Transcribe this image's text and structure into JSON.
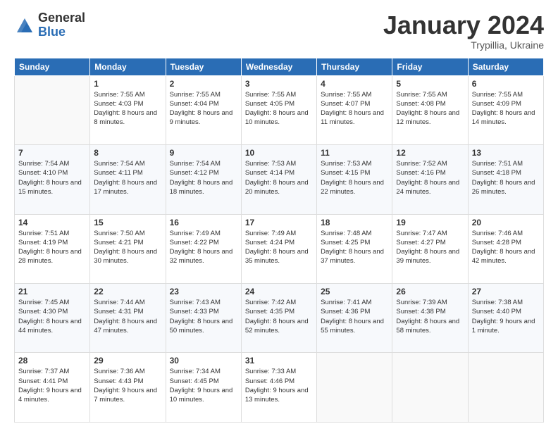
{
  "header": {
    "logo_general": "General",
    "logo_blue": "Blue",
    "month_title": "January 2024",
    "subtitle": "Trypillia, Ukraine"
  },
  "weekdays": [
    "Sunday",
    "Monday",
    "Tuesday",
    "Wednesday",
    "Thursday",
    "Friday",
    "Saturday"
  ],
  "weeks": [
    [
      {
        "day": "",
        "sunrise": "",
        "sunset": "",
        "daylight": ""
      },
      {
        "day": "1",
        "sunrise": "Sunrise: 7:55 AM",
        "sunset": "Sunset: 4:03 PM",
        "daylight": "Daylight: 8 hours and 8 minutes."
      },
      {
        "day": "2",
        "sunrise": "Sunrise: 7:55 AM",
        "sunset": "Sunset: 4:04 PM",
        "daylight": "Daylight: 8 hours and 9 minutes."
      },
      {
        "day": "3",
        "sunrise": "Sunrise: 7:55 AM",
        "sunset": "Sunset: 4:05 PM",
        "daylight": "Daylight: 8 hours and 10 minutes."
      },
      {
        "day": "4",
        "sunrise": "Sunrise: 7:55 AM",
        "sunset": "Sunset: 4:07 PM",
        "daylight": "Daylight: 8 hours and 11 minutes."
      },
      {
        "day": "5",
        "sunrise": "Sunrise: 7:55 AM",
        "sunset": "Sunset: 4:08 PM",
        "daylight": "Daylight: 8 hours and 12 minutes."
      },
      {
        "day": "6",
        "sunrise": "Sunrise: 7:55 AM",
        "sunset": "Sunset: 4:09 PM",
        "daylight": "Daylight: 8 hours and 14 minutes."
      }
    ],
    [
      {
        "day": "7",
        "sunrise": "Sunrise: 7:54 AM",
        "sunset": "Sunset: 4:10 PM",
        "daylight": "Daylight: 8 hours and 15 minutes."
      },
      {
        "day": "8",
        "sunrise": "Sunrise: 7:54 AM",
        "sunset": "Sunset: 4:11 PM",
        "daylight": "Daylight: 8 hours and 17 minutes."
      },
      {
        "day": "9",
        "sunrise": "Sunrise: 7:54 AM",
        "sunset": "Sunset: 4:12 PM",
        "daylight": "Daylight: 8 hours and 18 minutes."
      },
      {
        "day": "10",
        "sunrise": "Sunrise: 7:53 AM",
        "sunset": "Sunset: 4:14 PM",
        "daylight": "Daylight: 8 hours and 20 minutes."
      },
      {
        "day": "11",
        "sunrise": "Sunrise: 7:53 AM",
        "sunset": "Sunset: 4:15 PM",
        "daylight": "Daylight: 8 hours and 22 minutes."
      },
      {
        "day": "12",
        "sunrise": "Sunrise: 7:52 AM",
        "sunset": "Sunset: 4:16 PM",
        "daylight": "Daylight: 8 hours and 24 minutes."
      },
      {
        "day": "13",
        "sunrise": "Sunrise: 7:51 AM",
        "sunset": "Sunset: 4:18 PM",
        "daylight": "Daylight: 8 hours and 26 minutes."
      }
    ],
    [
      {
        "day": "14",
        "sunrise": "Sunrise: 7:51 AM",
        "sunset": "Sunset: 4:19 PM",
        "daylight": "Daylight: 8 hours and 28 minutes."
      },
      {
        "day": "15",
        "sunrise": "Sunrise: 7:50 AM",
        "sunset": "Sunset: 4:21 PM",
        "daylight": "Daylight: 8 hours and 30 minutes."
      },
      {
        "day": "16",
        "sunrise": "Sunrise: 7:49 AM",
        "sunset": "Sunset: 4:22 PM",
        "daylight": "Daylight: 8 hours and 32 minutes."
      },
      {
        "day": "17",
        "sunrise": "Sunrise: 7:49 AM",
        "sunset": "Sunset: 4:24 PM",
        "daylight": "Daylight: 8 hours and 35 minutes."
      },
      {
        "day": "18",
        "sunrise": "Sunrise: 7:48 AM",
        "sunset": "Sunset: 4:25 PM",
        "daylight": "Daylight: 8 hours and 37 minutes."
      },
      {
        "day": "19",
        "sunrise": "Sunrise: 7:47 AM",
        "sunset": "Sunset: 4:27 PM",
        "daylight": "Daylight: 8 hours and 39 minutes."
      },
      {
        "day": "20",
        "sunrise": "Sunrise: 7:46 AM",
        "sunset": "Sunset: 4:28 PM",
        "daylight": "Daylight: 8 hours and 42 minutes."
      }
    ],
    [
      {
        "day": "21",
        "sunrise": "Sunrise: 7:45 AM",
        "sunset": "Sunset: 4:30 PM",
        "daylight": "Daylight: 8 hours and 44 minutes."
      },
      {
        "day": "22",
        "sunrise": "Sunrise: 7:44 AM",
        "sunset": "Sunset: 4:31 PM",
        "daylight": "Daylight: 8 hours and 47 minutes."
      },
      {
        "day": "23",
        "sunrise": "Sunrise: 7:43 AM",
        "sunset": "Sunset: 4:33 PM",
        "daylight": "Daylight: 8 hours and 50 minutes."
      },
      {
        "day": "24",
        "sunrise": "Sunrise: 7:42 AM",
        "sunset": "Sunset: 4:35 PM",
        "daylight": "Daylight: 8 hours and 52 minutes."
      },
      {
        "day": "25",
        "sunrise": "Sunrise: 7:41 AM",
        "sunset": "Sunset: 4:36 PM",
        "daylight": "Daylight: 8 hours and 55 minutes."
      },
      {
        "day": "26",
        "sunrise": "Sunrise: 7:39 AM",
        "sunset": "Sunset: 4:38 PM",
        "daylight": "Daylight: 8 hours and 58 minutes."
      },
      {
        "day": "27",
        "sunrise": "Sunrise: 7:38 AM",
        "sunset": "Sunset: 4:40 PM",
        "daylight": "Daylight: 9 hours and 1 minute."
      }
    ],
    [
      {
        "day": "28",
        "sunrise": "Sunrise: 7:37 AM",
        "sunset": "Sunset: 4:41 PM",
        "daylight": "Daylight: 9 hours and 4 minutes."
      },
      {
        "day": "29",
        "sunrise": "Sunrise: 7:36 AM",
        "sunset": "Sunset: 4:43 PM",
        "daylight": "Daylight: 9 hours and 7 minutes."
      },
      {
        "day": "30",
        "sunrise": "Sunrise: 7:34 AM",
        "sunset": "Sunset: 4:45 PM",
        "daylight": "Daylight: 9 hours and 10 minutes."
      },
      {
        "day": "31",
        "sunrise": "Sunrise: 7:33 AM",
        "sunset": "Sunset: 4:46 PM",
        "daylight": "Daylight: 9 hours and 13 minutes."
      },
      {
        "day": "",
        "sunrise": "",
        "sunset": "",
        "daylight": ""
      },
      {
        "day": "",
        "sunrise": "",
        "sunset": "",
        "daylight": ""
      },
      {
        "day": "",
        "sunrise": "",
        "sunset": "",
        "daylight": ""
      }
    ]
  ]
}
